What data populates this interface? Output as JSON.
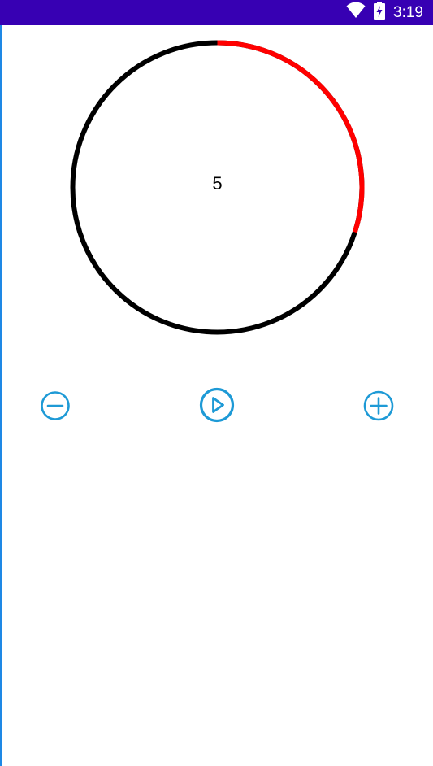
{
  "status_bar": {
    "time": "3:19",
    "icons": [
      "wifi-icon",
      "battery-charging-icon"
    ]
  },
  "timer": {
    "value": "5",
    "progress_fraction": 0.3,
    "progress_color": "#ff0000",
    "track_color": "#000000"
  },
  "controls": {
    "icons": [
      "minus-circle-icon",
      "play-circle-icon",
      "plus-circle-icon"
    ],
    "accent_color": "#1e9ad6"
  },
  "colors": {
    "status_bar": "#3700b3",
    "background": "#ffffff"
  }
}
